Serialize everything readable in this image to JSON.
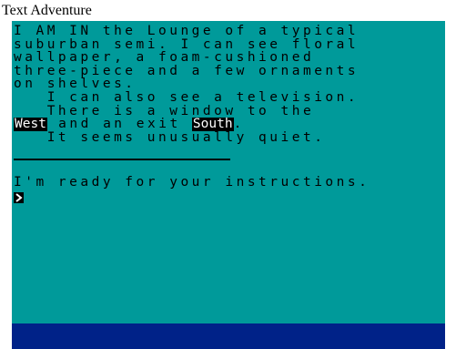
{
  "window": {
    "title": "Text Adventure"
  },
  "screen": {
    "background_color": "#009a9a",
    "border_color": "#002288",
    "ink_color": "#000000",
    "inverse_ink_color": "#ffffff"
  },
  "description": {
    "lines": [
      "I AM IN the Lounge of a typical",
      "suburban semi. I can see floral",
      "wallpaper, a foam-cushioned",
      "three-piece and a few ornaments",
      "on shelves.",
      "   I can also see a television.",
      "   There is a window to the"
    ],
    "exit_line": {
      "exit_west": "West",
      "middle_text": " and an exit ",
      "exit_south": "South",
      "end_text": "."
    },
    "last_line": "   It seems unusually quiet."
  },
  "prompt": {
    "message": "I'm ready for your instructions.",
    "cursor_glyph": ">",
    "command_value": ""
  }
}
